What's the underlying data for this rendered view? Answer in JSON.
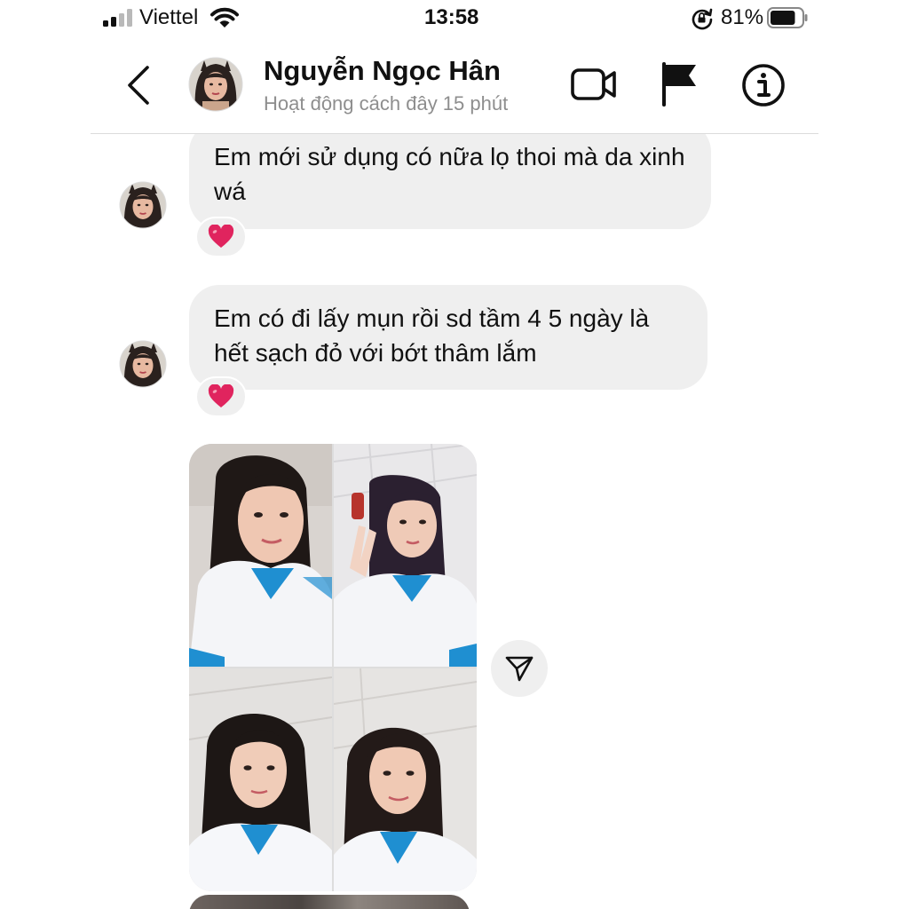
{
  "status_bar": {
    "carrier": "Viettel",
    "time": "13:58",
    "battery_percent": "81%",
    "battery_level": 0.81,
    "icons": [
      "signal-icon",
      "wifi-icon",
      "rotation-lock-icon",
      "battery-icon"
    ]
  },
  "header": {
    "contact_name": "Nguyễn Ngọc Hân",
    "activity_status": "Hoạt động cách đây 15 phút",
    "icons": [
      "back-chevron-icon",
      "video-call-icon",
      "report-flag-icon",
      "info-icon"
    ]
  },
  "messages": [
    {
      "type": "text",
      "from": "contact",
      "text": "Em mới sử dụng có nữa lọ thoi mà da xinh wá",
      "reaction": "❤️"
    },
    {
      "type": "text",
      "from": "contact",
      "text": "Em có đi lấy mụn rồi sd tầm 4 5 ngày là hết sạch đỏ với bớt thâm lắm",
      "reaction": "❤️"
    },
    {
      "type": "photos",
      "from": "contact",
      "count": 4
    }
  ],
  "colors": {
    "bubble_bg": "#efefef",
    "secondary_text": "#8e8e8e",
    "divider": "#dbdbdb",
    "heart": "#e0245e",
    "uniform_blue": "#1f8fd1"
  }
}
